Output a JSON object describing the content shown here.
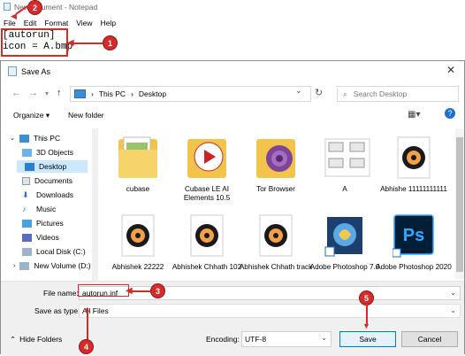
{
  "notepad": {
    "title": "New T  cument - Notepad",
    "menu": [
      "File",
      "Edit",
      "Format",
      "View",
      "Help"
    ],
    "text": "[autorun]\nicon = A.bmp"
  },
  "dialog": {
    "title": "Save As",
    "address": {
      "segments": [
        "This PC",
        "Desktop"
      ]
    },
    "search_placeholder": "Search Desktop",
    "toolbar": {
      "organize": "Organize ▾",
      "new_folder": "New folder"
    },
    "nav": [
      "This PC",
      "3D Objects",
      "Desktop",
      "Documents",
      "Downloads",
      "Music",
      "Pictures",
      "Videos",
      "Local Disk (C:)",
      "New Volume (D:)"
    ],
    "files_row1": [
      "cubase",
      "Cubase LE AI Elements 10.5",
      "Tor Browser",
      "A",
      "Abhishe 11111111111"
    ],
    "files_row2": [
      "Abhishek 22222",
      "Abhishek Chhath 102",
      "Abhishek Chhath track",
      "Adobe Photoshop 7.0",
      "Adobe Photoshop 2020"
    ],
    "file_name_label": "File name:",
    "file_name_value": "autorun.inf",
    "save_type_label": "Save as type:",
    "save_type_value": "All Files",
    "hide_folders": "Hide Folders",
    "encoding_label": "Encoding:",
    "encoding_value": "UTF-8",
    "save": "Save",
    "cancel": "Cancel"
  },
  "annotations": [
    "1",
    "2",
    "3",
    "4",
    "5"
  ],
  "colors": {
    "annotation": "#d62b2b",
    "selection": "#cce8ff",
    "folder": "#f3c44b",
    "ps_blue": "#31a8ff"
  }
}
